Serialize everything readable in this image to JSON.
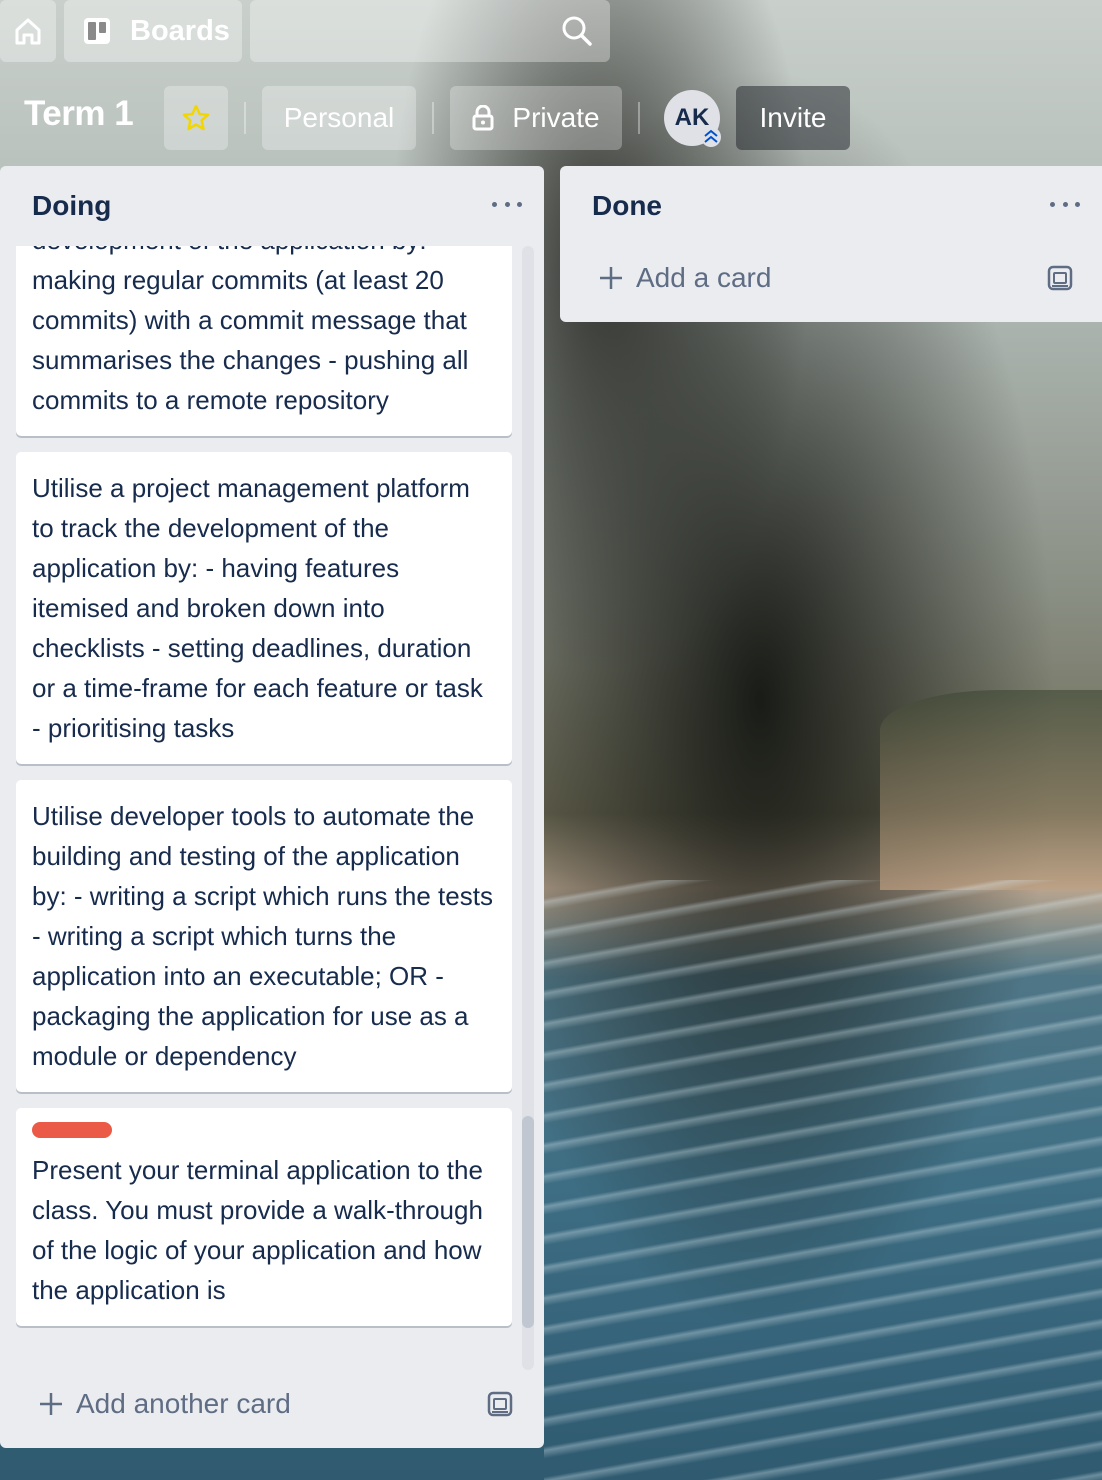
{
  "nav": {
    "boards_label": "Boards",
    "icons": [
      "home-icon",
      "boards-icon",
      "search-icon"
    ]
  },
  "board": {
    "title": "Term 1",
    "personal_label": "Personal",
    "private_label": "Private",
    "avatar_initials": "AK",
    "invite_label": "Invite",
    "star_color": "#f2d600"
  },
  "lists": {
    "doing": {
      "title": "Doing",
      "add_label": "Add another card",
      "cards": [
        {
          "text": "Utilise source control throughout the development of the application by: - making regular commits (at least 20 commits) with a commit message that summarises the changes - pushing all commits to a remote repository"
        },
        {
          "text": "Utilise a project management platform to track the development of the application by: - having features itemised and broken down into checklists - setting deadlines, duration or a time-frame for each feature or task - prioritising tasks"
        },
        {
          "text": "Utilise developer tools to automate the building and testing of the application by: - writing a script which runs the tests - writing a script which turns the application into an executable; OR - packaging the application for use as a module or dependency"
        },
        {
          "text": "Present your terminal application to the class. You must provide a walk-through of the logic of your application and how the application is",
          "label_color": "#eb5a46"
        }
      ]
    },
    "done": {
      "title": "Done",
      "add_label": "Add a card"
    }
  }
}
